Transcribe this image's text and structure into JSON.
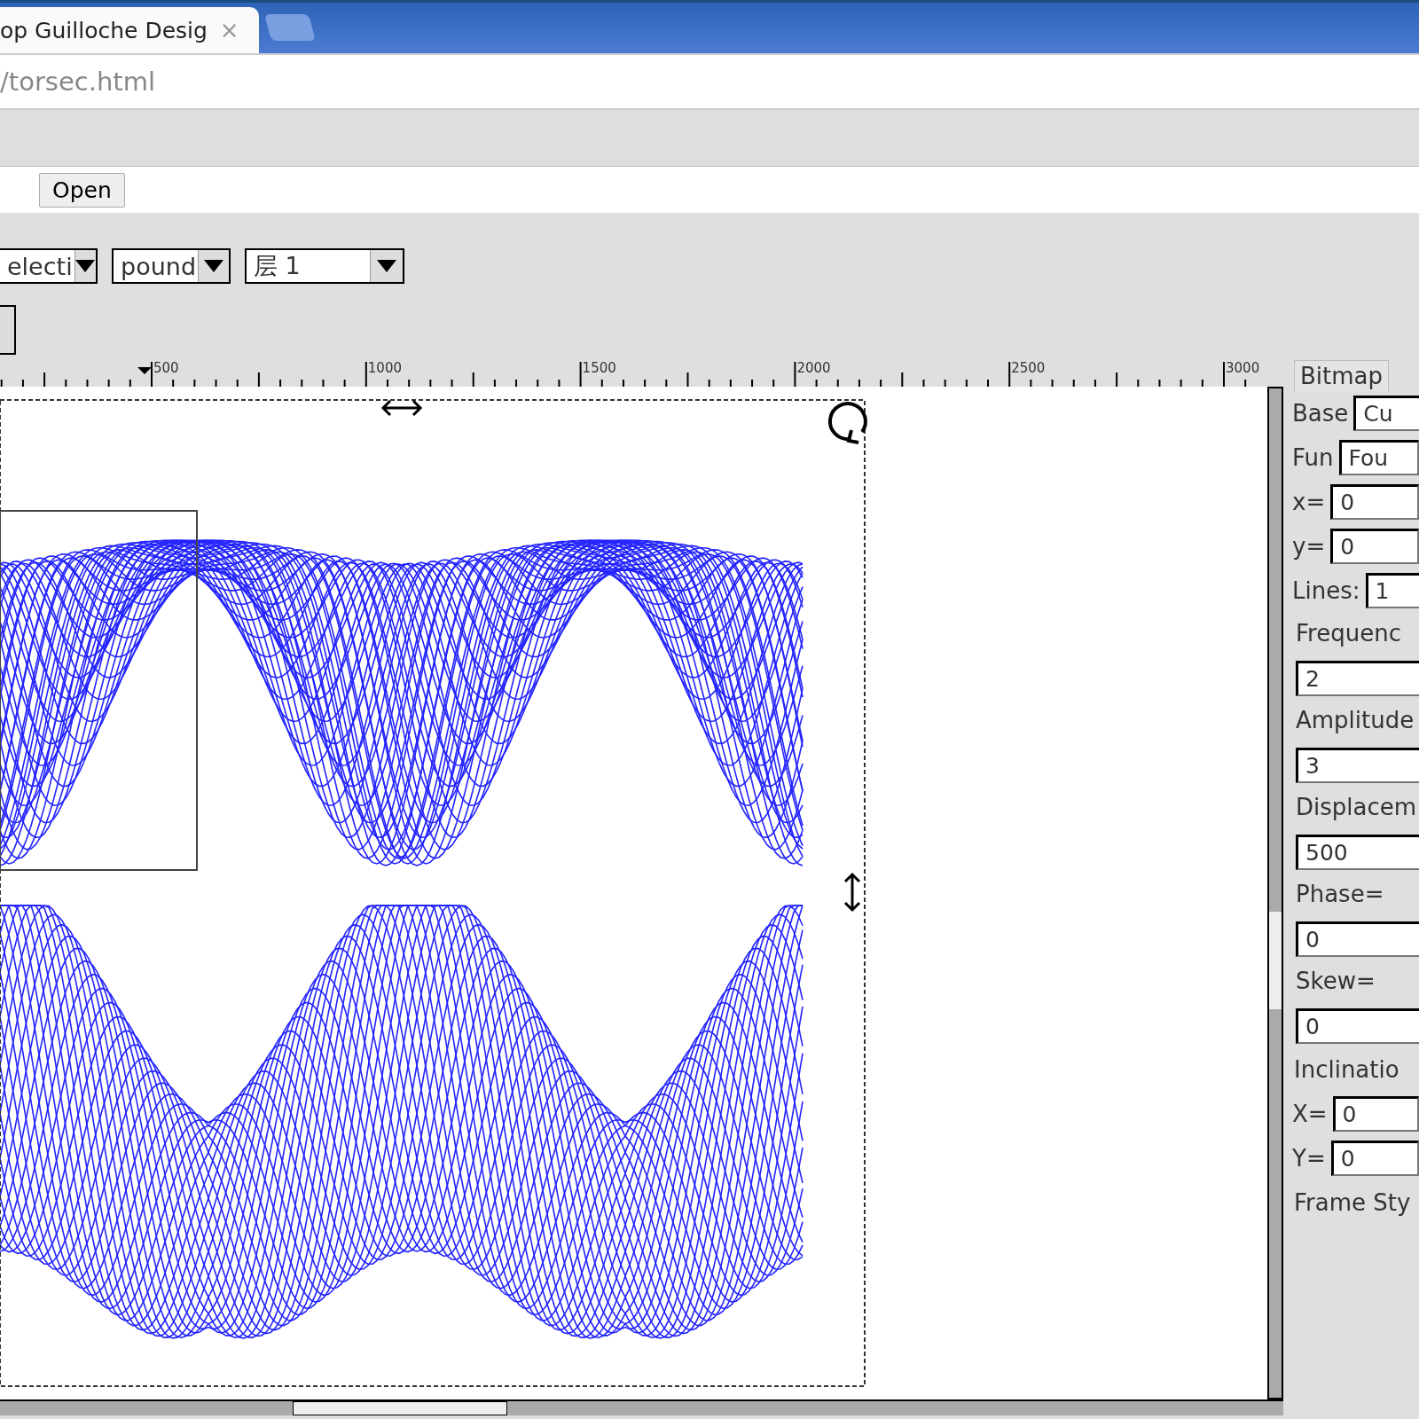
{
  "browser": {
    "tab": {
      "title": "op Guilloche Desig",
      "close": "×"
    },
    "url": "/torsec.html"
  },
  "toolbar": {
    "open_button": "Open",
    "selects": [
      {
        "value": "electi"
      },
      {
        "value": "pound"
      },
      {
        "value": "层 1"
      }
    ]
  },
  "ruler": {
    "labels": [
      "500",
      "1000",
      "1500",
      "2000",
      "2500",
      "3000"
    ]
  },
  "panel": {
    "tab": "Bitmap",
    "rows": [
      {
        "kind": "inline",
        "label": "Base",
        "value": "Cu"
      },
      {
        "kind": "inline",
        "label": "Fun",
        "value": "Fou"
      },
      {
        "kind": "inline",
        "label": "x=",
        "value": "0"
      },
      {
        "kind": "inline",
        "label": "y=",
        "value": "0"
      },
      {
        "kind": "inline",
        "label": "Lines:",
        "value": "1"
      },
      {
        "kind": "stacked",
        "label": "Frequenc",
        "value": "2"
      },
      {
        "kind": "stacked",
        "label": "Amplitude",
        "value": "3"
      },
      {
        "kind": "stacked",
        "label": "Displacem",
        "value": "500"
      },
      {
        "kind": "stacked",
        "label": "Phase=",
        "value": "0"
      },
      {
        "kind": "stacked",
        "label": "Skew=",
        "value": "0"
      },
      {
        "kind": "heading",
        "label": "Inclinatio"
      },
      {
        "kind": "inline",
        "label": "X=",
        "value": "0"
      },
      {
        "kind": "inline",
        "label": "Y=",
        "value": "0"
      },
      {
        "kind": "heading",
        "label": "Frame Sty"
      }
    ]
  }
}
